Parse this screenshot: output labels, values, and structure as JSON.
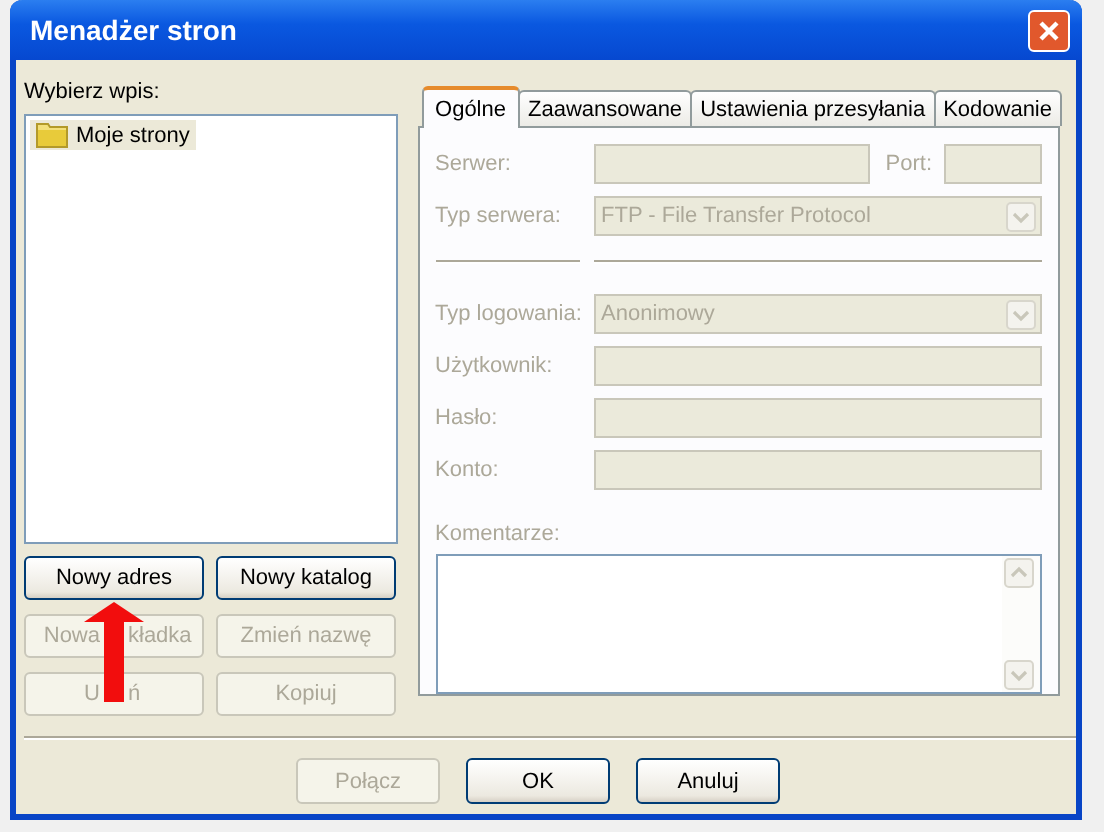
{
  "window": {
    "title": "Menadżer stron"
  },
  "site_list": {
    "label": "Wybierz wpis:",
    "items": [
      {
        "label": "Moje strony",
        "selected": true
      }
    ]
  },
  "site_buttons": [
    {
      "label": "Nowy adres",
      "disabled": false
    },
    {
      "label": "Nowy katalog",
      "disabled": false
    },
    {
      "label_parts": [
        "Nowa",
        "kładka"
      ],
      "disabled": true
    },
    {
      "label": "Zmień nazwę",
      "disabled": true
    },
    {
      "label_parts": [
        "U",
        "ń"
      ],
      "disabled": true
    },
    {
      "label": "Kopiuj",
      "disabled": true
    }
  ],
  "tabs": [
    {
      "label": "Ogólne",
      "selected": true
    },
    {
      "label": "Zaawansowane",
      "selected": false
    },
    {
      "label": "Ustawienia przesyłania",
      "selected": false
    },
    {
      "label": "Kodowanie",
      "selected": false
    }
  ],
  "fields": [
    {
      "kind": "server",
      "label": "Serwer:",
      "port_label": "Port:",
      "disabled": true
    },
    {
      "kind": "combo",
      "label": "Typ serwera:",
      "value": "FTP - File Transfer Protocol",
      "disabled": true
    },
    {
      "kind": "separator"
    },
    {
      "kind": "combo",
      "label": "Typ logowania:",
      "value": "Anonimowy",
      "disabled": true
    },
    {
      "kind": "text",
      "label": "Użytkownik:",
      "disabled": true
    },
    {
      "kind": "text",
      "label": "Hasło:",
      "disabled": true
    },
    {
      "kind": "text",
      "label": "Konto:",
      "disabled": true
    }
  ],
  "comments": {
    "label": "Komentarze:",
    "disabled": true
  },
  "bottom_buttons": [
    {
      "label": "Połącz",
      "disabled": true
    },
    {
      "label": "OK",
      "disabled": false
    },
    {
      "label": "Anuluj",
      "disabled": false
    }
  ]
}
